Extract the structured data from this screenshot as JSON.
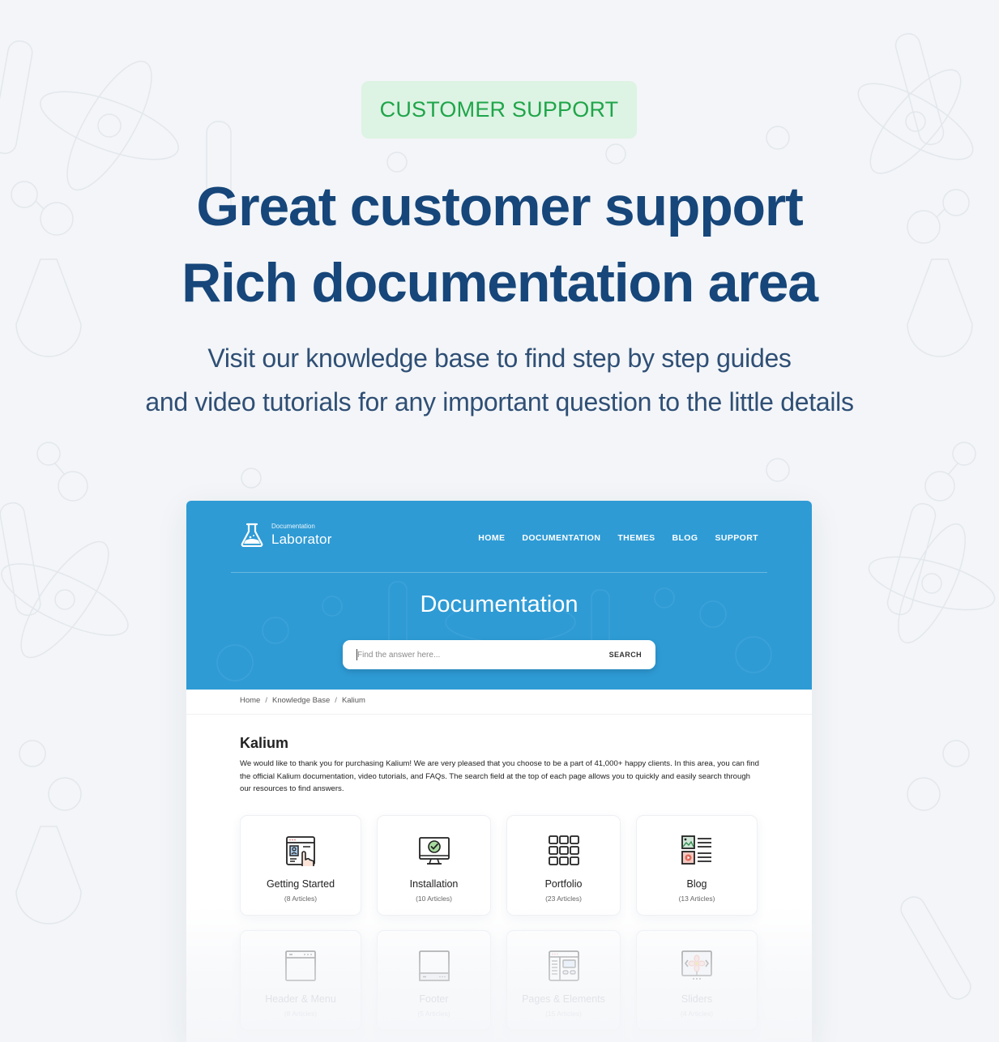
{
  "badge": {
    "label": "CUSTOMER SUPPORT",
    "bg_color": "#ddf3e3",
    "text_color": "#1fa54a"
  },
  "headline": {
    "line1": "Great customer support",
    "line2": "Rich documentation area",
    "color": "#16467a"
  },
  "subheadline": {
    "line1": "Visit our knowledge base to find step by step guides",
    "line2": "and video tutorials for any important question to the little details"
  },
  "mockup": {
    "brand_color": "#2e9bd5",
    "logo": {
      "small": "Documentation",
      "big": "Laborator",
      "icon": "flask-icon"
    },
    "nav": [
      "HOME",
      "DOCUMENTATION",
      "THEMES",
      "BLOG",
      "SUPPORT"
    ],
    "hero_title": "Documentation",
    "search": {
      "placeholder": "Find the answer here...",
      "value": "",
      "button_label": "SEARCH"
    },
    "breadcrumb": [
      "Home",
      "Knowledge Base",
      "Kalium"
    ],
    "breadcrumb_separator": "/",
    "kb": {
      "title": "Kalium",
      "description": "We would like to thank you for purchasing Kalium! We are very pleased that you choose to be a part of 41,000+ happy clients. In this area, you can find the official Kalium documentation, video tutorials, and FAQs. The search field at the top of each page allows you to quickly and easily search through our resources to find answers."
    },
    "categories": [
      {
        "name": "Getting Started",
        "count": "(8 Articles)",
        "icon": "getting-started-icon"
      },
      {
        "name": "Installation",
        "count": "(10 Articles)",
        "icon": "monitor-check-icon"
      },
      {
        "name": "Portfolio",
        "count": "(23 Articles)",
        "icon": "grid-icon"
      },
      {
        "name": "Blog",
        "count": "(13 Articles)",
        "icon": "blog-posts-icon"
      },
      {
        "name": "Header & Menu",
        "count": "(8 Articles)",
        "icon": "header-window-icon"
      },
      {
        "name": "Footer",
        "count": "(5 Articles)",
        "icon": "footer-window-icon"
      },
      {
        "name": "Pages & Elements",
        "count": "(15 Articles)",
        "icon": "page-layout-icon"
      },
      {
        "name": "Sliders",
        "count": "(4 Articles)",
        "icon": "slider-icon"
      }
    ]
  }
}
